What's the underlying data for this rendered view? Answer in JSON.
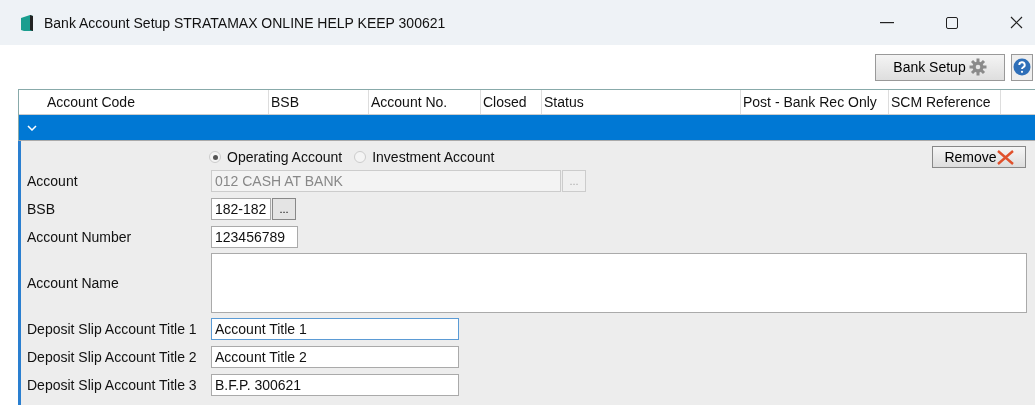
{
  "window": {
    "title": "Bank Account Setup STRATAMAX ONLINE HELP KEEP 300621"
  },
  "toolbar": {
    "bank_setup_button": "Bank Setup"
  },
  "table": {
    "columns": [
      "Account Code",
      "BSB",
      "Account No.",
      "Closed",
      "Status",
      "Post - Bank Rec Only",
      "SCM Reference"
    ],
    "rows": [
      {
        "expanded": true,
        "selected": true
      }
    ]
  },
  "detail": {
    "account_type": [
      {
        "label": "Operating Account",
        "selected": true
      },
      {
        "label": "Investment Account",
        "selected": false
      }
    ],
    "remove_button": "Remove",
    "fields": [
      {
        "kind": "lookup",
        "label": "Account",
        "value": "012 CASH AT BANK",
        "disabled": true,
        "button": "...",
        "focused": false
      },
      {
        "kind": "lookup",
        "label": "BSB",
        "value": "182-182",
        "disabled": false,
        "button": "...",
        "focused": false
      },
      {
        "kind": "short",
        "label": "Account Number",
        "value": "123456789",
        "disabled": false,
        "focused": false
      },
      {
        "kind": "multiline",
        "label": "Account Name",
        "disabled": false,
        "focused": false
      },
      {
        "kind": "text",
        "label": "Deposit Slip Account Title 1",
        "value": "Account Title 1",
        "disabled": false,
        "focused": true
      },
      {
        "kind": "text",
        "label": "Deposit Slip Account Title 2",
        "value": "Account Title 2",
        "disabled": false,
        "focused": false
      },
      {
        "kind": "text",
        "label": "Deposit Slip Account Title 3",
        "value": "B.F.P. 300621",
        "disabled": false,
        "focused": false
      }
    ]
  }
}
